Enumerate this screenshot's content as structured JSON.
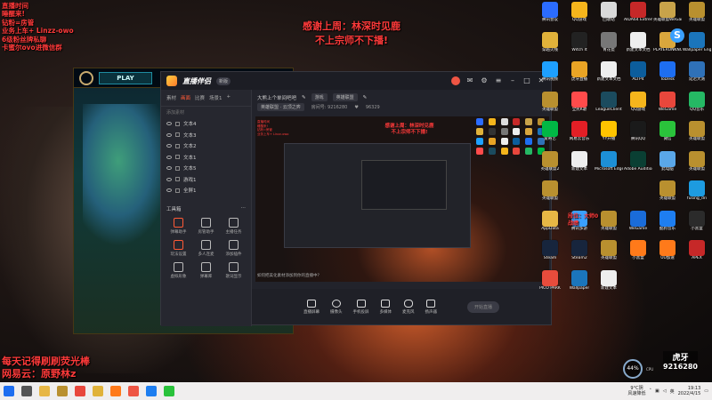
{
  "overlay": {
    "left_lines": [
      "直播时间",
      "睡醒来!",
      "钻粉=房管",
      "业务上车+ Linzz-owo",
      "6级粉丝牌私聊",
      "卡蜜尔ovo进微信群"
    ],
    "center_line1": "感谢上周：林深时见鹿",
    "center_line2": "不上宗师不下播!",
    "bottom_line1": "每天记得刷刷荧光棒",
    "bottom_line2": "网易云：原野林z"
  },
  "lol": {
    "play": "PLAY"
  },
  "stream_app": {
    "title": "直播伴侣",
    "version": "新版",
    "scene_tabs": [
      "素材",
      "画面",
      "比赛",
      "场景1"
    ],
    "scene_add": "添加素材",
    "scenes": [
      "文本4",
      "文本3",
      "文本2",
      "文本1",
      "文本5",
      "游戏1",
      "全屏1"
    ],
    "tools_title": "工具箱",
    "tools": [
      "弹幕助手",
      "房管助手",
      "主播任务",
      "玩法设置",
      "多人连麦",
      "添加插件",
      "虚拟形象",
      "弹幕库",
      "歌词显示",
      "高能榜",
      "PK",
      "更多"
    ],
    "room_title": "大熊上个单间吧吧",
    "room_tag": "游戏",
    "room_category": "英雄联盟",
    "room_zone": "英雄联盟 · 云顶之弈",
    "room_id": "房间号: 9216280",
    "fans": "96329",
    "controls": [
      "直播屏幕",
      "摄像头",
      "手机投屏",
      "多媒体",
      "麦克风",
      "扬声器"
    ],
    "start_live": "开始直播",
    "chat_line": "如何把美化素材添加到你的直播中?"
  },
  "desktop": {
    "rank_note_1": "段位：大师0",
    "rank_note_2": "战绩",
    "icons": [
      {
        "label": "腾讯会议",
        "color": "#2b6cff"
      },
      {
        "label": "QQ游戏",
        "color": "#f5b51c"
      },
      {
        "label": "回收站",
        "color": "#d9d9d9"
      },
      {
        "label": "AIDA64 Extreme",
        "color": "#c62828"
      },
      {
        "label": "英雄联盟WeGame版",
        "color": "#c8a34a"
      },
      {
        "label": "英雄联盟",
        "color": "#b9902f"
      },
      {
        "label": "穿越火线",
        "color": "#e0b23a"
      },
      {
        "label": "Witch It",
        "color": "#222"
      },
      {
        "label": "青花瓷",
        "color": "#777"
      },
      {
        "label": "新建文本文档",
        "color": "#eee"
      },
      {
        "label": "PLAYERUNKNOWN'S BATTLEGR",
        "color": "#d9a63d"
      },
      {
        "label": "Wallpaper Engine",
        "color": "#1b75bb"
      },
      {
        "label": "腾讯视频",
        "color": "#1ea0ff"
      },
      {
        "label": "虎牙直播",
        "color": "#e9a425"
      },
      {
        "label": "新建文本文档",
        "color": "#eee"
      },
      {
        "label": "ALTP4",
        "color": "#0c5d9c"
      },
      {
        "label": "ToDesk",
        "color": "#1e6ef0"
      },
      {
        "label": "延迟大测",
        "color": "#2f71b8"
      },
      {
        "label": "英雄联盟",
        "color": "#b9902f"
      },
      {
        "label": "全民K歌",
        "color": "#ff4b4b"
      },
      {
        "label": "LeagueClient",
        "color": "#1b4b5e"
      },
      {
        "label": "QQ游戏",
        "color": "#f5b51c"
      },
      {
        "label": "WeGame",
        "color": "#e8473c"
      },
      {
        "label": "QQ音乐",
        "color": "#25b864"
      },
      {
        "label": "爱奇艺",
        "color": "#00b845"
      },
      {
        "label": "网易云音乐",
        "color": "#e21f26"
      },
      {
        "label": "YY开播",
        "color": "#ffc400"
      },
      {
        "label": "腾讯QQ",
        "color": "#1a1a1a"
      },
      {
        "label": "微信",
        "color": "#2ac23b"
      },
      {
        "label": "英雄联盟",
        "color": "#b9902f"
      },
      {
        "label": "英雄联盟2",
        "color": "#b9902f"
      },
      {
        "label": "新建文本",
        "color": "#eee"
      },
      {
        "label": "Microsoft Edge",
        "color": "#1d8fd6"
      },
      {
        "label": "Adobe Audition",
        "color": "#0a3f33"
      },
      {
        "label": "此电脑",
        "color": "#5aa7e8"
      },
      {
        "label": "英雄联盟",
        "color": "#b9902f"
      },
      {
        "label": "英雄联盟",
        "color": "#b9902f"
      },
      {
        "label": "英雄联盟",
        "color": "#b9902f"
      },
      {
        "label": "fusing_dri",
        "color": "#1d9be0"
      },
      {
        "label": "AppData",
        "color": "#e7b745"
      },
      {
        "label": "腾讯多游",
        "color": "#3aa0ff"
      },
      {
        "label": "英雄联盟",
        "color": "#b9902f"
      },
      {
        "label": "WeGame",
        "color": "#1a6cd9"
      },
      {
        "label": "酷狗音乐",
        "color": "#1e7ef0"
      },
      {
        "label": "小黑盒",
        "color": "#2b2b2b"
      },
      {
        "label": "Steam",
        "color": "#17253d"
      },
      {
        "label": "Steam2",
        "color": "#17253d"
      },
      {
        "label": "英雄联盟",
        "color": "#b9902f"
      },
      {
        "label": "小黑盒",
        "color": "#ff7a1a"
      },
      {
        "label": "UU加速",
        "color": "#ff7a1a"
      },
      {
        "label": "APEX",
        "color": "#c62828"
      },
      {
        "label": "PICO PARK",
        "color": "#e74c3c"
      },
      {
        "label": "Wallpaper",
        "color": "#1b75bb"
      },
      {
        "label": "新建文本",
        "color": "#eee"
      }
    ]
  },
  "sysmon": {
    "cpu": "44%",
    "cpu_label": "CPU",
    "live_logo": "虎牙",
    "live_num": "9216280"
  },
  "taskbar": {
    "apps": [
      {
        "name": "start",
        "color": "#1e6ef0"
      },
      {
        "name": "search",
        "color": "#555"
      },
      {
        "name": "explorer",
        "color": "#e7b745"
      },
      {
        "name": "lol",
        "color": "#b9902f"
      },
      {
        "name": "chrome",
        "color": "#e8473c"
      },
      {
        "name": "app5",
        "color": "#e0b23a"
      },
      {
        "name": "app6",
        "color": "#ff7a1a"
      },
      {
        "name": "app7",
        "color": "#e54"
      },
      {
        "name": "app8",
        "color": "#1e7ef0"
      },
      {
        "name": "app9",
        "color": "#2ac23b"
      }
    ],
    "weather_1": "9°C阴",
    "weather_2": "风速降低",
    "lang": "英",
    "time": "19:13",
    "date": "2022/4/15"
  }
}
